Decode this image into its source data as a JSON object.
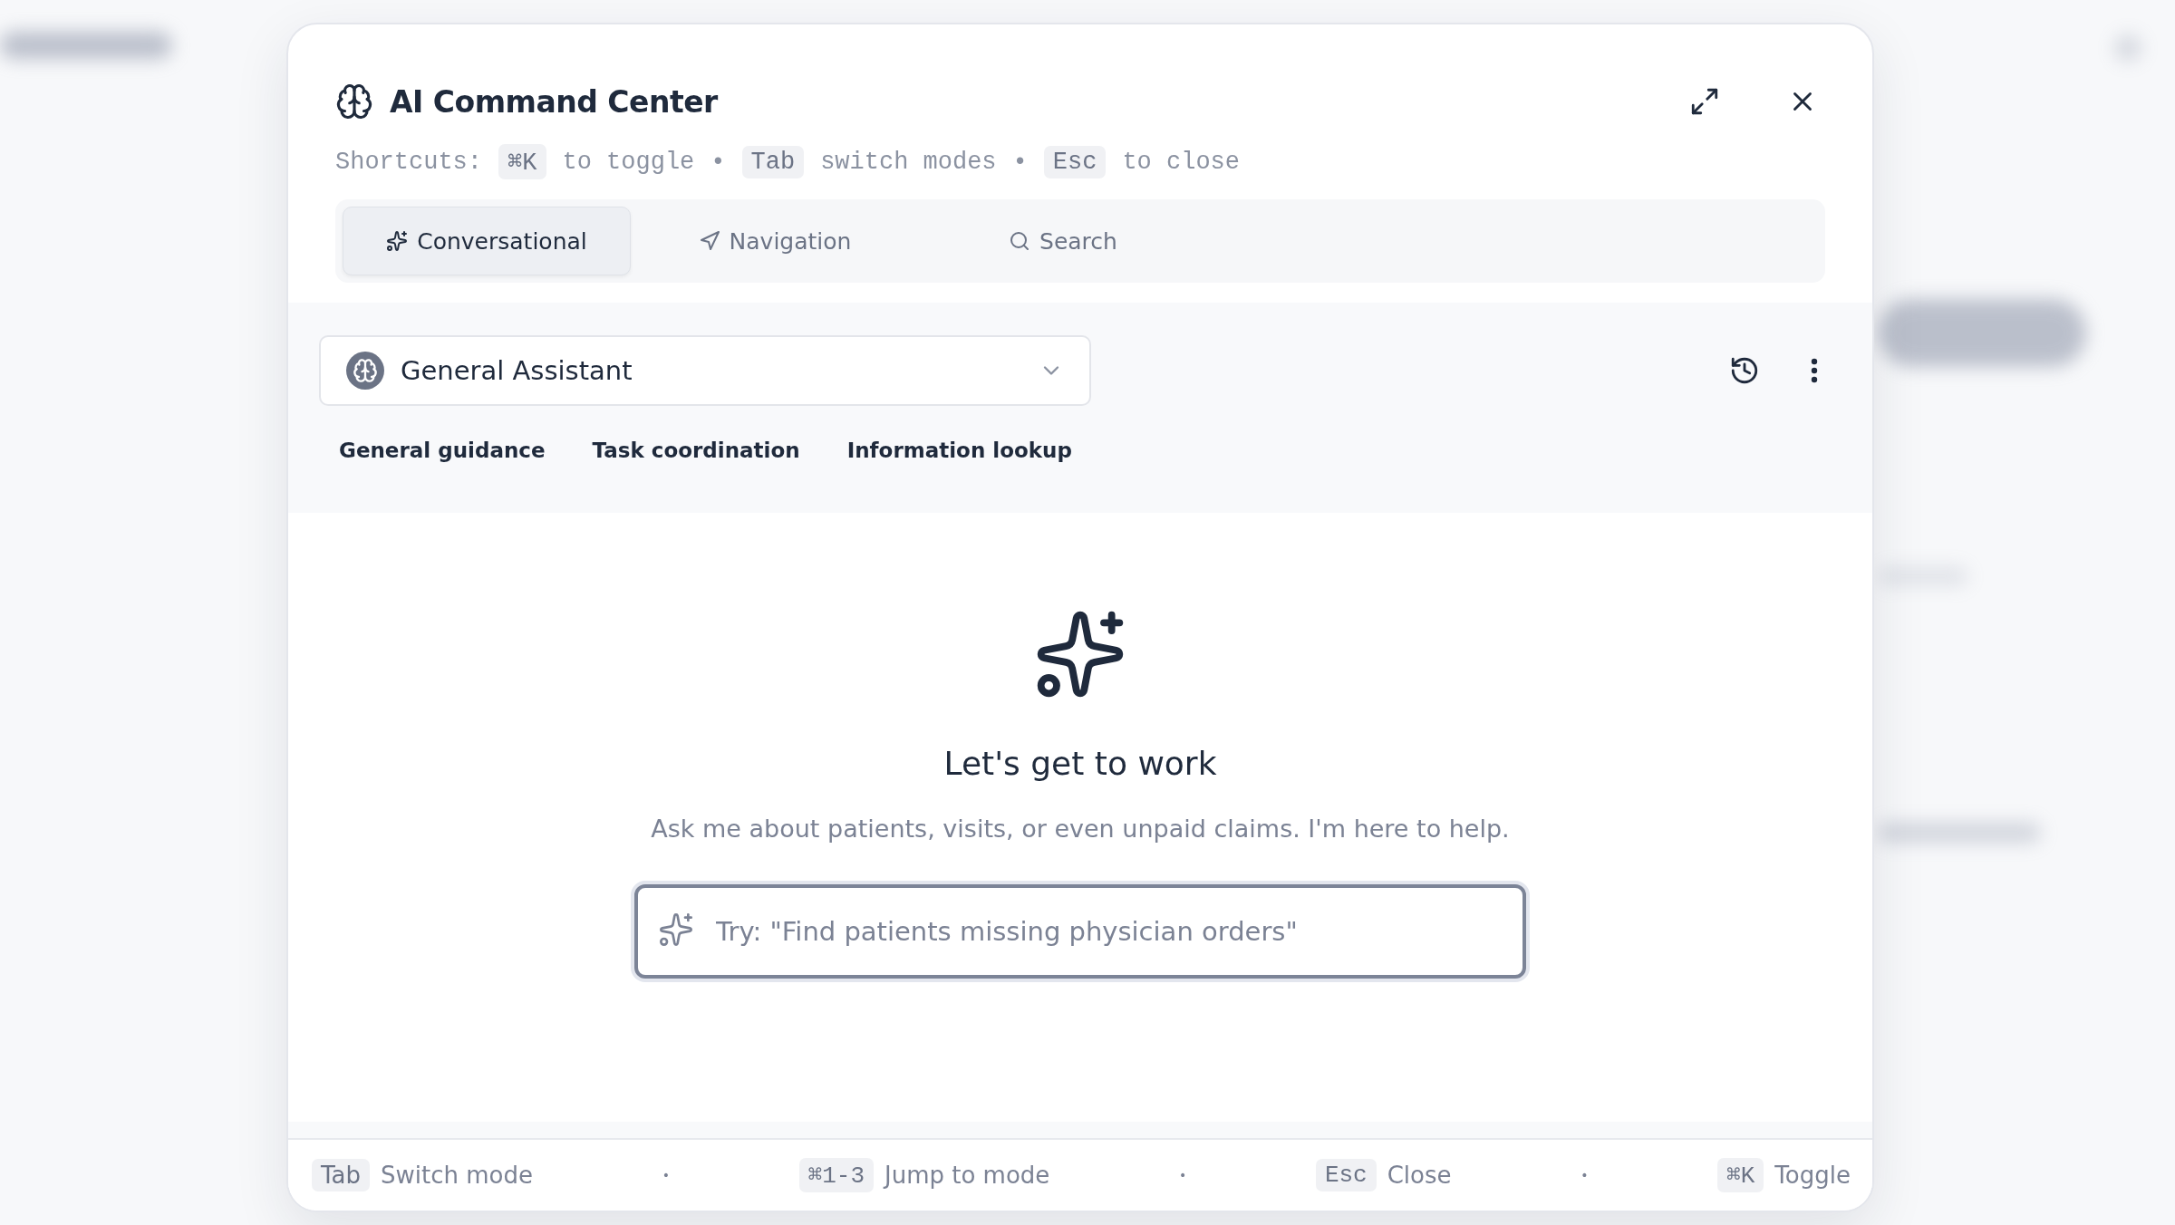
{
  "dialog": {
    "title": "AI Command Center",
    "shortcuts": [
      {
        "kind": "text",
        "text": "Shortcuts:"
      },
      {
        "kind": "key",
        "text": "⌘K"
      },
      {
        "kind": "text",
        "text": "to toggle"
      },
      {
        "kind": "dot",
        "text": "•"
      },
      {
        "kind": "key",
        "text": "Tab"
      },
      {
        "kind": "text",
        "text": "switch modes"
      },
      {
        "kind": "dot",
        "text": "•"
      },
      {
        "kind": "key",
        "text": "Esc"
      },
      {
        "kind": "text",
        "text": "to close"
      }
    ],
    "tabs": [
      {
        "label": "Conversational",
        "selected": true
      },
      {
        "label": "Navigation",
        "selected": false
      },
      {
        "label": "Search",
        "selected": false
      }
    ],
    "assistant": {
      "name": "General Assistant",
      "capabilities": [
        "General guidance",
        "Task coordination",
        "Information lookup"
      ]
    },
    "empty_state": {
      "heading": "Let's get to work",
      "subtitle": "Ask me about patients, visits, or even unpaid claims. I'm here to help.",
      "input": {
        "placeholder": "Try: \"Find patients missing physician orders\""
      }
    },
    "footer": [
      {
        "kind": "hint",
        "key": "Tab",
        "label": "Switch mode"
      },
      {
        "kind": "dot",
        "text": "•"
      },
      {
        "kind": "hint",
        "key": "⌘1-3",
        "label": "Jump to mode"
      },
      {
        "kind": "dot",
        "text": "•"
      },
      {
        "kind": "hint",
        "key": "Esc",
        "label": "Close"
      },
      {
        "kind": "dot",
        "text": "•"
      },
      {
        "kind": "hint",
        "key": "⌘K",
        "label": "Toggle"
      }
    ]
  }
}
